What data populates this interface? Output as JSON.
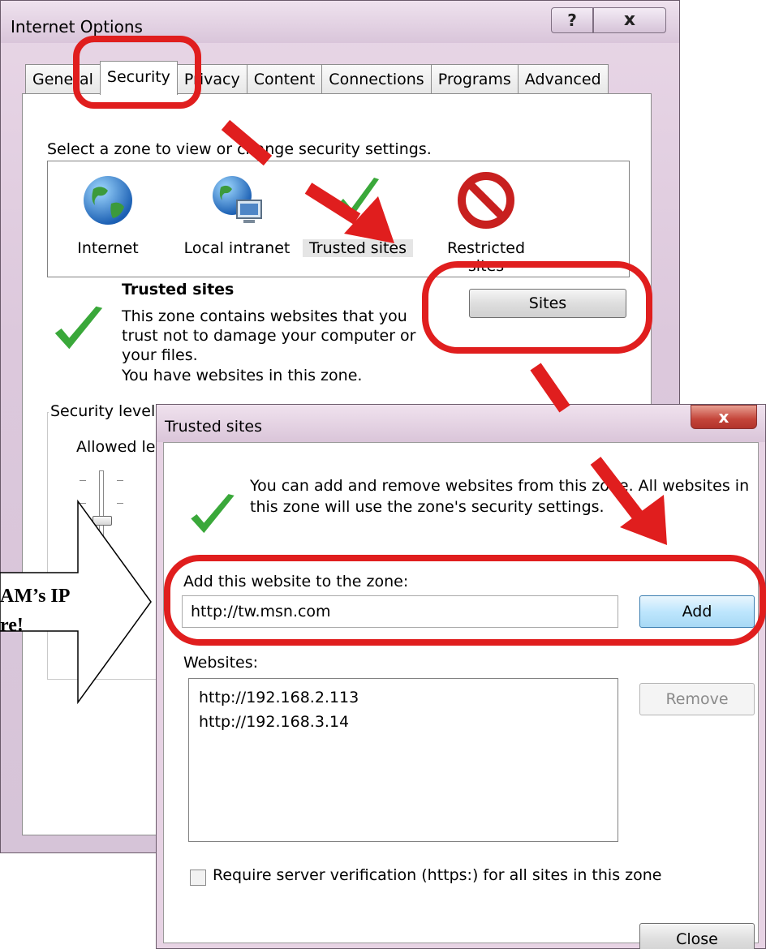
{
  "internet_options": {
    "title": "Internet Options",
    "help_label": "?",
    "close_label": "x",
    "tabs": [
      "General",
      "Security",
      "Privacy",
      "Content",
      "Connections",
      "Programs",
      "Advanced"
    ],
    "active_tab": "Security",
    "zone_prompt": "Select a zone to view or change security settings.",
    "zones": [
      {
        "label": "Internet",
        "icon": "globe-icon"
      },
      {
        "label": "Local intranet",
        "icon": "intranet-globe-icon"
      },
      {
        "label": "Trusted sites",
        "icon": "checkmark-icon"
      },
      {
        "label": "Restricted sites",
        "icon": "prohibited-icon"
      }
    ],
    "selected_zone": {
      "title": "Trusted sites",
      "description": "This zone contains websites that you trust not to damage your computer or your files.",
      "note": "You have websites in this zone."
    },
    "sites_button": "Sites",
    "security_level_legend": "Security level for this zone",
    "allowed_levels": "Allowed levels for this zone"
  },
  "trusted_sites": {
    "title": "Trusted sites",
    "close_label": "x",
    "info": "You can add and remove websites from this zone. All websites in this zone will use the zone's security settings.",
    "add_label": "Add this website to the zone:",
    "url_value": "http://tw.msn.com",
    "add_button": "Add",
    "websites_label": "Websites:",
    "websites": [
      "http://192.168.2.113",
      "http://192.168.3.14"
    ],
    "remove_button": "Remove",
    "require_https_label": "Require server verification (https:) for all sites in this zone",
    "require_https_checked": false,
    "close_button": "Close"
  },
  "callout": {
    "line1": "AM’s IP",
    "line2": "re!"
  },
  "colors": {
    "annotation_red": "#e01e1e",
    "check_green": "#3aa83a"
  }
}
